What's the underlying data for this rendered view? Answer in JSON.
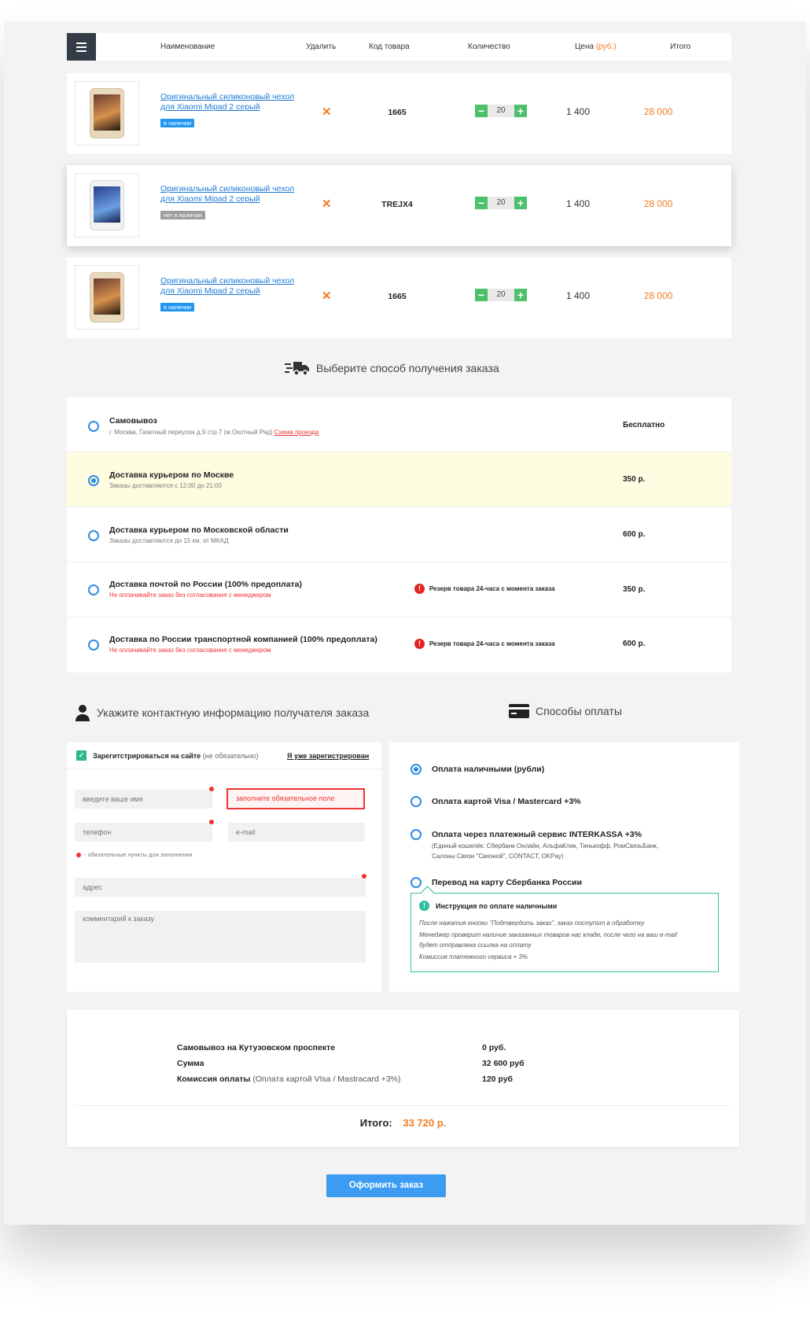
{
  "table_header": {
    "name": "Наименование",
    "delete": "Удалить",
    "code": "Код товара",
    "quantity": "Количество",
    "price": "Цена",
    "price_unit": "(руб.)",
    "total": "Итого"
  },
  "items": [
    {
      "name": "Оригинальный силиконовый чехол для Xiaomi Mipad 2 серый",
      "stock": "в наличии",
      "code": "1665",
      "qty": "20",
      "price": "1 400",
      "total": "28 000"
    },
    {
      "name": "Оригинальный силиконовый чехол для Xiaomi Mipad 2 серый",
      "stock": "нет в наличии",
      "code": "TREJX4",
      "qty": "20",
      "price": "1 400",
      "total": "28 000"
    },
    {
      "name": "Оригинальный силиконовый чехол для Xiaomi Mipad 2 серый",
      "stock": "в наличии",
      "code": "1665",
      "qty": "20",
      "price": "1 400",
      "total": "28 000"
    }
  ],
  "delivery": {
    "title": "Выберите способ получения заказа",
    "options": [
      {
        "name": "Самовывоз",
        "sub": "г. Москва, Газетный переулок д.9 стр.7 (м.Охотный Ряд)",
        "link": "Схема проезда",
        "price": "Бесплатно"
      },
      {
        "name": "Доставка курьером по Москве",
        "sub": "Заказы доставляются с 12:00 до 21:00",
        "price": "350 р."
      },
      {
        "name": "Доставка курьером по Московской области",
        "sub": "Заказы доставляются до 15 км. от МКАД",
        "price": "600 р."
      },
      {
        "name": "Доставка почтой по России (100% предоплата)",
        "sub": "Не оплачивайте заказ без согласования с менеджером",
        "warn": "Резерв товара 24-часа с момента заказа",
        "price": "350 р."
      },
      {
        "name": "Доставка по России транспортной компанией (100% предоплата)",
        "sub": "Не оплачивайте заказ без согласования с менеджером",
        "warn": "Резерв товара 24-часа с момента заказа",
        "price": "600 р."
      }
    ]
  },
  "contact": {
    "title": "Укажите контактную информацию получателя заказа",
    "register_label": "Зарегитстрироваться на сайте",
    "register_optional": "(не обязательно)",
    "already_registered": "Я уже зарегистрирован",
    "name_placeholder": "введите ваше имя",
    "error_text": "заполните обязательное поле",
    "phone_placeholder": "телефон",
    "email_placeholder": "e-mail",
    "required_note": "- обязательные пункты для заполнения",
    "address_placeholder": "адрес",
    "comment_placeholder": "комментарий к заказу"
  },
  "payment": {
    "title": "Способы оплаты",
    "options": [
      {
        "name": "Оплата наличными (рубли)"
      },
      {
        "name": "Оплата картой Visa / Mastercard +3%"
      },
      {
        "name": "Оплата через платежный сервис INTERKASSA +3%",
        "sub1": "(Единый кошелёк: Сбербанк Онлайн, АльфаКлик, Тинькофф, РомСвязьБанк,",
        "sub2": "Салоны Связи \"Связной\", CONTACT, OKPay)"
      },
      {
        "name": "Перевод на карту Сбербанка России"
      }
    ],
    "instruction_title": "Инструкция по оплате наличными",
    "instruction_lines": [
      "После нажатия кнопки \"Подтвердить заказ\", заказ поступит в обработку",
      "Менеджер проверит наличие заказанных товаров нас кладе, после чего на ваш e-mail",
      "будет отправлена ссылка на оплату",
      "Комиссия платежного сервиса + 3%"
    ]
  },
  "summary": {
    "pickup_label": "Самовывоз на Кутузовском проспекте",
    "pickup_value": "0 руб.",
    "sum_label": "Сумма",
    "sum_value": "32 600 руб",
    "fee_label": "Комиссия оплаты",
    "fee_note": "(Оплата картой VIsa / Mastracard +3%)",
    "fee_value": "120 руб",
    "total_label": "Итого:",
    "total_value": "33 720 р."
  },
  "submit_label": "Оформить заказ",
  "colors": {
    "accent": "#f47b20",
    "primary": "#3b9cf2",
    "success": "#4cc06b",
    "error": "#e33333",
    "dark": "#333c47"
  }
}
